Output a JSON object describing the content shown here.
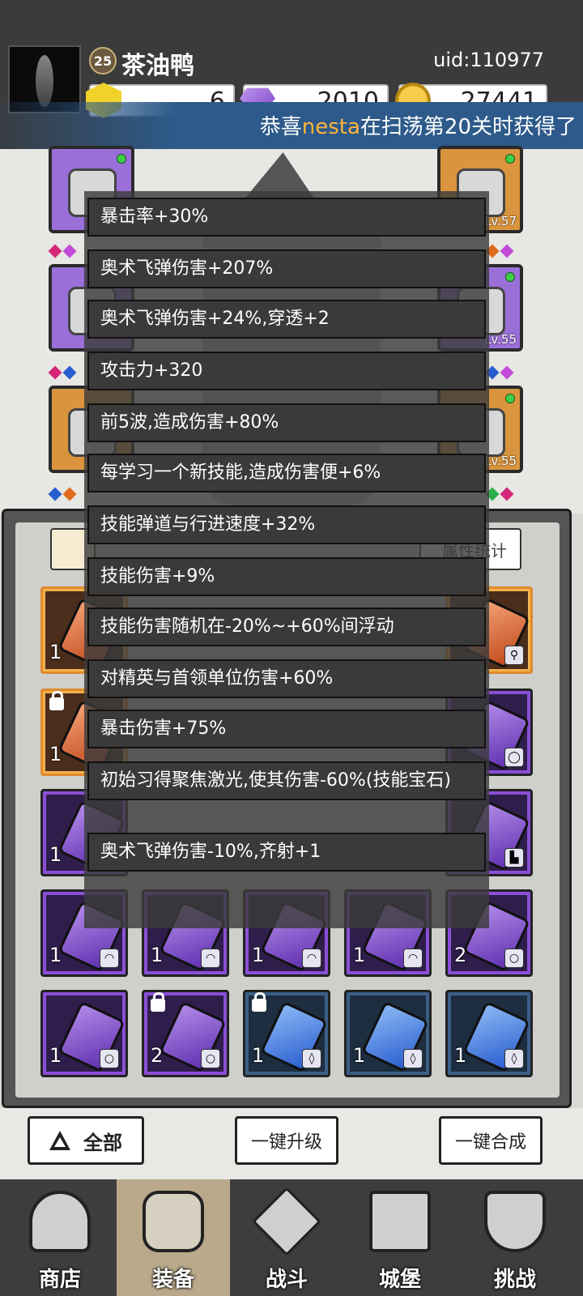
{
  "header": {
    "level": "25",
    "player_name": "茶油鸭",
    "uid": "uid:110977",
    "resources": [
      {
        "icon": "energy-icon",
        "value": "6"
      },
      {
        "icon": "diamond-icon",
        "value": "2010"
      },
      {
        "icon": "coin-icon",
        "value": "27441"
      }
    ]
  },
  "marquee": {
    "prefix": "恭喜",
    "highlight": "nesta",
    "suffix": "在扫荡第20关时获得了"
  },
  "equipment": {
    "slots": [
      {
        "icon": "hat-icon",
        "level": ""
      },
      {
        "icon": "pipe-icon",
        "level": "Lv.57"
      },
      {
        "icon": "cloak-icon",
        "level": ""
      },
      {
        "icon": "ring-icon",
        "level": "Lv.55"
      },
      {
        "icon": "boot-icon",
        "level": ""
      },
      {
        "icon": "necklace-icon",
        "level": "Lv.55"
      }
    ]
  },
  "inventory": {
    "stats_button": "属性统计",
    "cells": [
      {
        "color": "orange",
        "qty": "1",
        "locked": false
      },
      {
        "color": "orange",
        "qty": "",
        "locked": false
      },
      {
        "color": "orange",
        "qty": "1",
        "locked": true
      },
      {
        "color": "purple",
        "qty": "",
        "locked": false
      },
      {
        "color": "purple",
        "qty": "1",
        "locked": false
      },
      {
        "color": "purple",
        "qty": "",
        "locked": false
      },
      {
        "color": "purple",
        "qty": "1",
        "locked": false
      },
      {
        "color": "purple",
        "qty": "1",
        "locked": false
      },
      {
        "color": "purple",
        "qty": "1",
        "locked": false
      },
      {
        "color": "purple",
        "qty": "1",
        "locked": false
      },
      {
        "color": "purple",
        "qty": "2",
        "locked": false
      },
      {
        "color": "purple",
        "qty": "1",
        "locked": false
      },
      {
        "color": "purple",
        "qty": "2",
        "locked": true
      },
      {
        "color": "blue",
        "qty": "1",
        "locked": true
      },
      {
        "color": "blue",
        "qty": "1",
        "locked": false
      },
      {
        "color": "blue",
        "qty": "1",
        "locked": false
      }
    ]
  },
  "tooltip": {
    "lines": [
      "暴击率+30%",
      "奥术飞弹伤害+207%",
      "奥术飞弹伤害+24%,穿透+2",
      "攻击力+320",
      "前5波,造成伤害+80%",
      "每学习一个新技能,造成伤害便+6%",
      "技能弹道与行进速度+32%",
      "技能伤害+9%",
      "技能伤害随机在-20%~+60%间浮动",
      "对精英与首领单位伤害+60%",
      "暴击伤害+75%",
      "初始习得聚焦激光,使其伤害-60%(技能宝石)",
      "奥术飞弹伤害-10%,齐射+1"
    ]
  },
  "actions": {
    "all": "全部",
    "upgrade_all": "一键升级",
    "merge_all": "一键合成"
  },
  "nav": [
    {
      "label": "商店",
      "icon": "shop-icon"
    },
    {
      "label": "装备",
      "icon": "backpack-icon"
    },
    {
      "label": "战斗",
      "icon": "crossed-swords-icon"
    },
    {
      "label": "城堡",
      "icon": "castle-icon"
    },
    {
      "label": "挑战",
      "icon": "shield-icon"
    }
  ],
  "colors": {
    "accent_orange": "#ffb43a",
    "purple_gem": "#8a4fd6",
    "blue_gem": "#3b5f88",
    "orange_gem": "#e08a2d"
  }
}
